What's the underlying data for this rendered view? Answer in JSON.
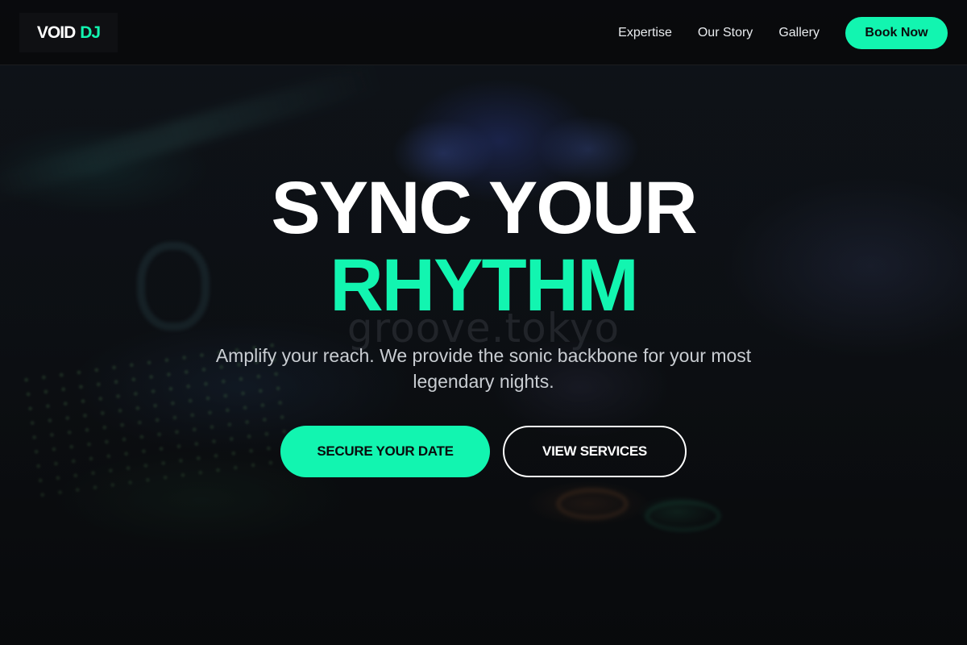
{
  "brand": {
    "logo_primary": "VOID",
    "logo_accent": "DJ"
  },
  "nav": {
    "links": [
      {
        "label": "Expertise"
      },
      {
        "label": "Our Story"
      },
      {
        "label": "Gallery"
      }
    ],
    "cta_label": "Book Now"
  },
  "hero": {
    "title_line1": "SYNC YOUR",
    "title_line2": "RHYTHM",
    "subtitle": "Amplify your reach. We provide the sonic backbone for your most legendary nights.",
    "primary_button": "SECURE YOUR DATE",
    "secondary_button": "VIEW SERVICES",
    "watermark": "groove.tokyo"
  },
  "colors": {
    "accent": "#12f5b0",
    "background": "#0b0c0e",
    "text_primary": "#ffffff",
    "text_muted": "#c9cdd2"
  }
}
